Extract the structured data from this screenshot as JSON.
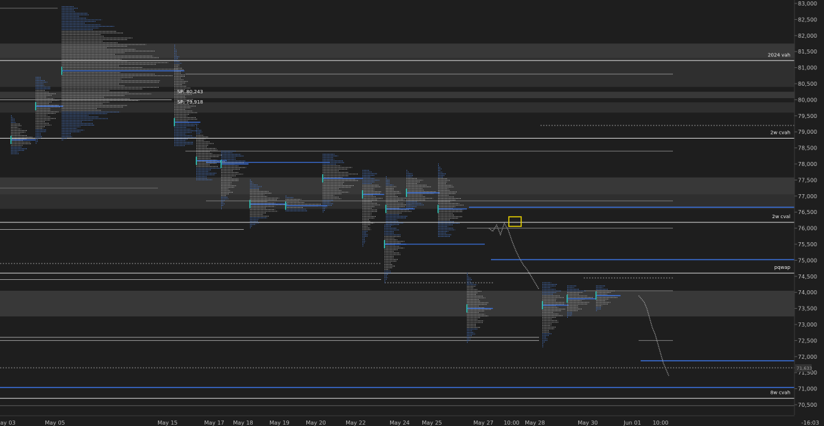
{
  "chart_data": {
    "type": "market-profile",
    "x_ticks": [
      "May 03",
      "May 05",
      "May 15",
      "May 17",
      "May 18",
      "May 19",
      "May 20",
      "May 22",
      "May 24",
      "May 25",
      "May 27",
      "10:00",
      "May 28",
      "May 30",
      "Jun 01",
      "10:00"
    ],
    "y_ticks": [
      83000,
      82500,
      82000,
      81500,
      81000,
      80500,
      80000,
      79500,
      79000,
      78500,
      78000,
      77500,
      77000,
      76500,
      76000,
      75500,
      75000,
      74500,
      74000,
      73500,
      73000,
      72500,
      72000,
      71500,
      71000,
      70500
    ],
    "ylim": [
      70300,
      83100
    ],
    "last_price": {
      "label": "71,633",
      "value": 71633
    },
    "countdown": "-16:03",
    "level_labels": [
      {
        "label": "2024 vah",
        "value": 81220
      },
      {
        "label": "2w cvah",
        "value": 78800
      },
      {
        "label": "2w cval",
        "value": 76180
      },
      {
        "label": "pqwap",
        "value": 74600
      },
      {
        "label": "8w cvah",
        "value": 70700
      }
    ],
    "annotations": [
      {
        "label": "SP: 80,243",
        "value": 80243
      },
      {
        "label": "SP: 79,918",
        "value": 79918
      }
    ],
    "zones": [
      {
        "from": 81300,
        "to": 81750
      },
      {
        "from": 80400,
        "to": 81300
      },
      {
        "from": 80050,
        "to": 80250
      },
      {
        "from": 79600,
        "to": 79920
      },
      {
        "from": 77050,
        "to": 77580
      },
      {
        "from": 76600,
        "to": 77050
      },
      {
        "from": 73250,
        "to": 74050
      }
    ],
    "profiles": [
      {
        "session": "May 03",
        "low": 78300,
        "high": 79500,
        "poc": 78750,
        "width": 0.6
      },
      {
        "session": "May 04",
        "low": 78600,
        "high": 80700,
        "poc": 79800,
        "width": 0.7
      },
      {
        "session": "May 05",
        "low": 78700,
        "high": 82900,
        "poc": 80900,
        "width": 1.0
      },
      {
        "session": "May 15",
        "low": 78550,
        "high": 81700,
        "poc": 79300,
        "width": 0.55
      },
      {
        "session": "May 17",
        "low": 77500,
        "high": 79200,
        "poc": 78100,
        "width": 0.65
      },
      {
        "session": "May 17b",
        "low": 76600,
        "high": 78400,
        "poc": 78000,
        "width": 0.6
      },
      {
        "session": "May 18",
        "low": 76000,
        "high": 77500,
        "poc": 76750,
        "width": 0.75
      },
      {
        "session": "May 19",
        "low": 76500,
        "high": 77000,
        "poc": 76700,
        "width": 0.8
      },
      {
        "session": "May 20",
        "low": 76500,
        "high": 78300,
        "poc": 77550,
        "width": 0.85
      },
      {
        "session": "May 22",
        "low": 75400,
        "high": 77800,
        "poc": 77050,
        "width": 0.45
      },
      {
        "session": "May 24",
        "low": 74300,
        "high": 76100,
        "poc": 75500,
        "width": 0.45
      },
      {
        "session": "May 24b",
        "low": 76100,
        "high": 77600,
        "poc": 76600,
        "width": 0.6
      },
      {
        "session": "May 25",
        "low": 76600,
        "high": 77800,
        "poc": 77100,
        "width": 0.6
      },
      {
        "session": "May 27",
        "low": 75700,
        "high": 78000,
        "poc": 76600,
        "width": 0.55
      },
      {
        "session": "May 28",
        "low": 72400,
        "high": 74600,
        "poc": 73500,
        "width": 0.6
      },
      {
        "session": "May 28b",
        "low": 72300,
        "high": 74300,
        "poc": 73600,
        "width": 0.7
      },
      {
        "session": "May 30",
        "low": 73200,
        "high": 74200,
        "poc": 73800,
        "width": 0.6
      },
      {
        "session": "May 31",
        "low": 73400,
        "high": 74200,
        "poc": 73900,
        "width": 0.5
      }
    ],
    "price_path": [
      [
        0.0,
        76000
      ],
      [
        0.2,
        75900
      ],
      [
        0.4,
        76100
      ],
      [
        0.6,
        75800
      ],
      [
        0.8,
        76150
      ],
      [
        1.0,
        75950
      ],
      [
        1.2,
        75600
      ],
      [
        1.4,
        75300
      ],
      [
        1.6,
        75050
      ],
      [
        1.8,
        74850
      ],
      [
        2.0,
        74700
      ],
      [
        2.2,
        74500
      ],
      [
        2.4,
        74300
      ],
      [
        2.6,
        74100
      ]
    ],
    "price_path_b": [
      [
        0.0,
        73900
      ],
      [
        0.2,
        73800
      ],
      [
        0.4,
        73700
      ],
      [
        0.6,
        73500
      ],
      [
        0.8,
        73200
      ],
      [
        1.0,
        72900
      ],
      [
        1.2,
        72700
      ],
      [
        1.4,
        72400
      ],
      [
        1.6,
        72100
      ],
      [
        1.8,
        71800
      ],
      [
        2.0,
        71600
      ],
      [
        2.2,
        71400
      ]
    ]
  }
}
